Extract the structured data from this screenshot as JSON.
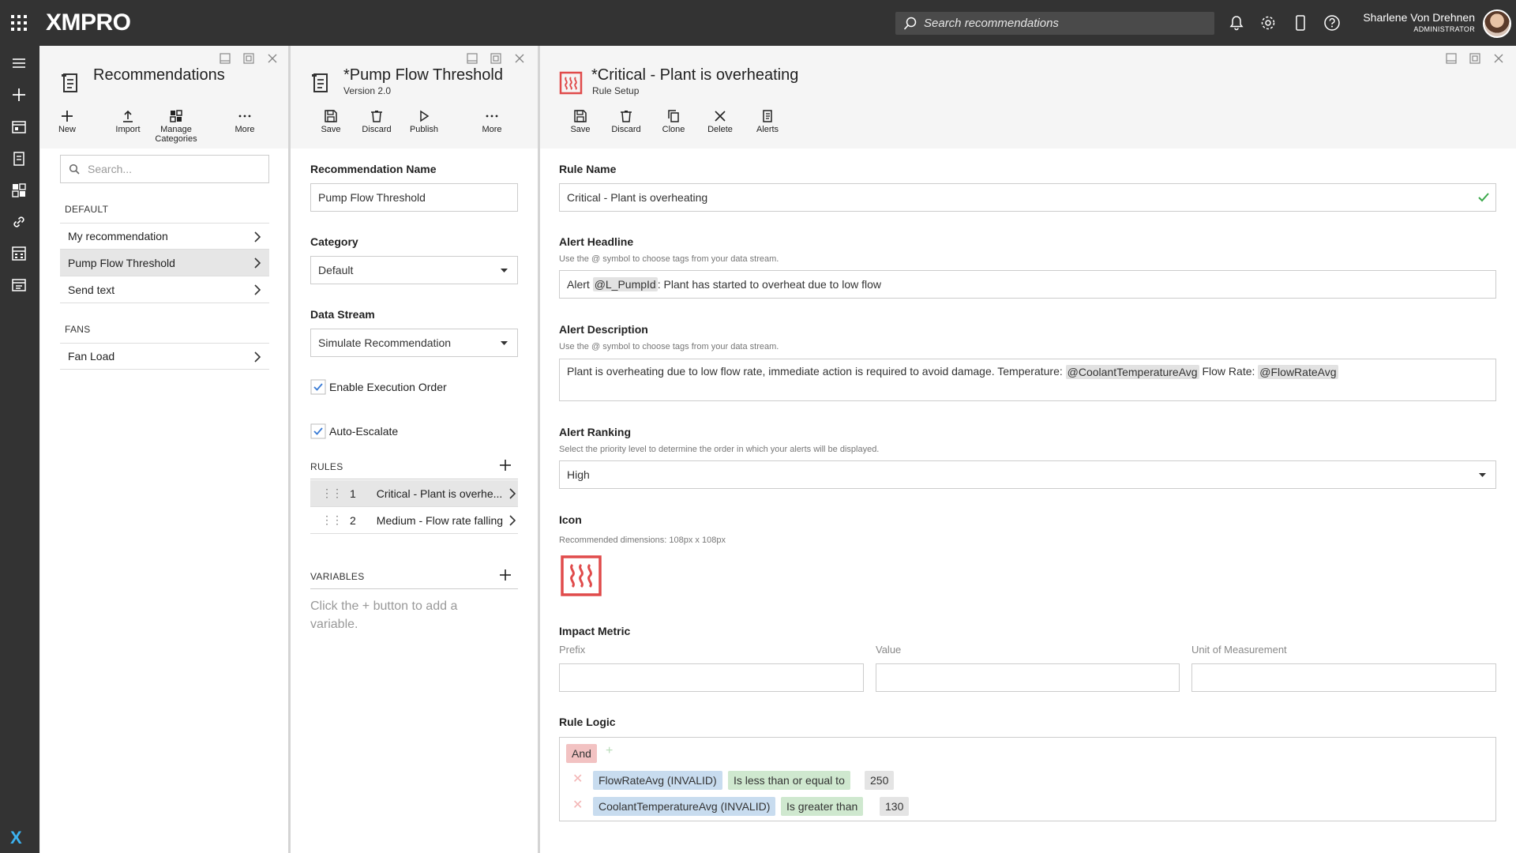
{
  "topbar": {
    "logo": "XMPRO",
    "search_placeholder": "Search recommendations",
    "user_name": "Sharlene Von Drehnen",
    "user_role": "ADMINISTRATOR"
  },
  "panel1": {
    "title": "Recommendations",
    "tools": [
      "New",
      "Import",
      "Manage\nCategories",
      "More"
    ],
    "tool_new": "New",
    "tool_import": "Import",
    "tool_manage_1": "Manage",
    "tool_manage_2": "Categories",
    "tool_more": "More",
    "search_placeholder": "Search...",
    "groups": [
      {
        "name": "DEFAULT",
        "items": [
          "My recommendation",
          "Pump Flow Threshold",
          "Send text"
        ]
      },
      {
        "name": "FANS",
        "items": [
          "Fan Load"
        ]
      }
    ]
  },
  "panel2": {
    "title": "*Pump Flow Threshold",
    "subtitle": "Version 2.0",
    "tool_save": "Save",
    "tool_discard": "Discard",
    "tool_publish": "Publish",
    "tool_more": "More",
    "name_label": "Recommendation Name",
    "name_value": "Pump Flow Threshold",
    "category_label": "Category",
    "category_value": "Default",
    "stream_label": "Data Stream",
    "stream_value": "Simulate Recommendation",
    "enable_exec": "Enable Execution Order",
    "auto_escalate": "Auto-Escalate",
    "rules_header": "RULES",
    "rules": [
      {
        "num": "1",
        "name": "Critical - Plant is overhe..."
      },
      {
        "num": "2",
        "name": "Medium - Flow rate falling"
      }
    ],
    "variables_header": "VARIABLES",
    "variables_empty": "Click the + button to add a variable."
  },
  "panel3": {
    "title": "*Critical - Plant is overheating",
    "subtitle": "Rule Setup",
    "tool_save": "Save",
    "tool_discard": "Discard",
    "tool_clone": "Clone",
    "tool_delete": "Delete",
    "tool_alerts": "Alerts",
    "rule_name_label": "Rule Name",
    "rule_name_value": "Critical - Plant is overheating",
    "headline_label": "Alert Headline",
    "headline_hint": "Use the @ symbol to choose tags from your data stream.",
    "headline_pre": "Alert ",
    "headline_tag": "@L_PumpId",
    "headline_post": ": Plant has started to overheat due to low flow",
    "desc_label": "Alert Description",
    "desc_hint": "Use the @ symbol to choose tags from your data stream.",
    "desc_pre": "Plant is overheating due to low flow rate, immediate action is required to avoid damage. Temperature: ",
    "desc_tag1": "@CoolantTemperatureAvg",
    "desc_mid": " Flow Rate: ",
    "desc_tag2": "@FlowRateAvg",
    "ranking_label": "Alert Ranking",
    "ranking_hint": "Select the priority level to determine the order in which your alerts will be displayed.",
    "ranking_value": "High",
    "icon_label": "Icon",
    "icon_hint": "Recommended dimensions: 108px x 108px",
    "impact_label": "Impact Metric",
    "impact_prefix": "Prefix",
    "impact_value": "Value",
    "impact_unit": "Unit of Measurement",
    "logic_label": "Rule Logic",
    "logic_op": "And",
    "conditions": [
      {
        "field": "FlowRateAvg (INVALID)",
        "op": "Is less than or equal to",
        "value": "250"
      },
      {
        "field": "CoolantTemperatureAvg (INVALID)",
        "op": "Is greater than",
        "value": "130"
      }
    ]
  },
  "colors": {
    "topbar": "#333333",
    "accent_red": "#e04b4b",
    "check_green": "#3aa84a"
  }
}
